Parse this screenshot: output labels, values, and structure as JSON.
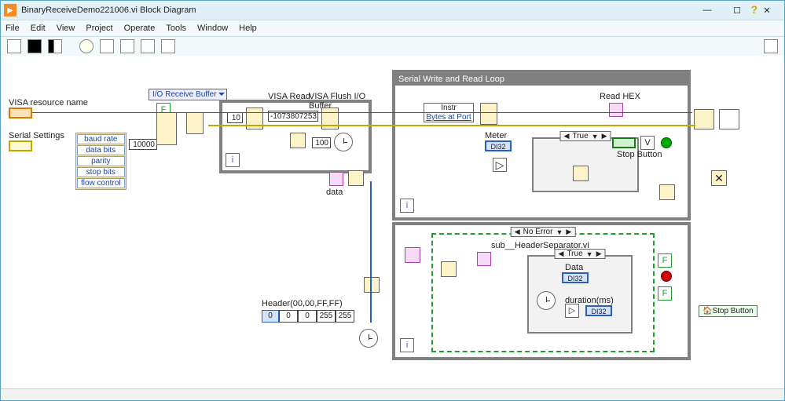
{
  "window": {
    "title": "BinaryReceiveDemo221006.vi Block Diagram"
  },
  "menu": [
    "File",
    "Edit",
    "View",
    "Project",
    "Operate",
    "Tools",
    "Window",
    "Help"
  ],
  "controls": {
    "visa_resource": "VISA resource name",
    "serial_settings": "Serial Settings",
    "settings_items": [
      "baud rate",
      "data bits",
      "parity",
      "stop bits",
      "flow control"
    ],
    "timeout_val": "10000",
    "io_buffer_mode": "I/O Receive Buffer"
  },
  "read_loop": {
    "buf_size": "10",
    "read_label": "VISA Read",
    "flush_label": "VISA Flush I/O Buffer",
    "err_code": "-1073807253",
    "wait_ms": "100",
    "data_label": "data"
  },
  "write_read": {
    "title": "Serial Write and Read Loop",
    "instr_label": "Instr",
    "bytes_at_port": "Bytes at Port",
    "read_hex": "Read HEX",
    "meter": "Meter",
    "meter_type": "DI32",
    "case_sel": "True",
    "stop_btn": "Stop Button"
  },
  "lower": {
    "case_sel": "No Error",
    "sub_vi": "sub__HeaderSeparator.vi",
    "inner_case": "True",
    "data_label": "Data",
    "data_type": "DI32",
    "duration_label": "duration(ms)",
    "duration_type": "DI32",
    "header_label": "Header(00,00,FF,FF)",
    "header_idx": "0",
    "header_vals": [
      "0",
      "0",
      "255",
      "255"
    ],
    "stop_btn": "Stop Button"
  },
  "winbtns": {
    "min": "—",
    "max": "☐",
    "close": "✕"
  }
}
